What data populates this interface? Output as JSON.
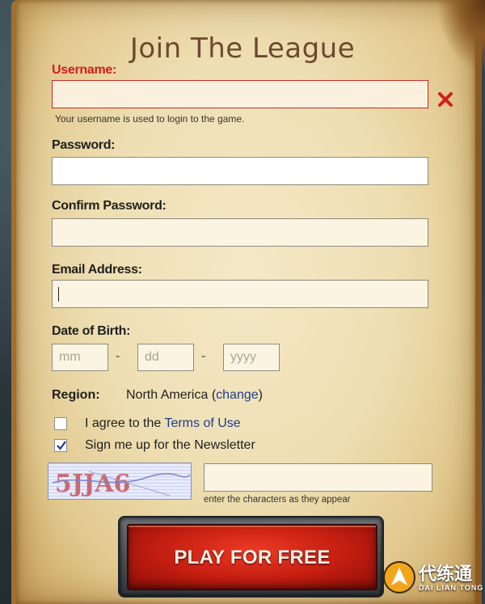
{
  "form": {
    "title": "Join The League",
    "username": {
      "label": "Username:",
      "value": "",
      "hint": "Your username is used to login to the game.",
      "error": true
    },
    "password": {
      "label": "Password:",
      "value": ""
    },
    "confirm_password": {
      "label": "Confirm Password:",
      "value": ""
    },
    "email": {
      "label": "Email Address:",
      "value": ""
    },
    "date_of_birth": {
      "label": "Date of Birth:",
      "month_placeholder": "mm",
      "day_placeholder": "dd",
      "year_placeholder": "yyyy",
      "separator": "-"
    },
    "region": {
      "label": "Region:",
      "value": "North America",
      "open_paren": "(",
      "change_link": "change",
      "close_paren": ")"
    },
    "terms": {
      "checked": false,
      "text": "I agree to the ",
      "link": "Terms of Use"
    },
    "newsletter": {
      "checked": true,
      "text": "Sign me up for the Newsletter"
    },
    "captcha": {
      "image_text": "5JJA6",
      "input_value": "",
      "hint": "enter the characters as they appear"
    },
    "submit_label": "PLAY FOR FREE"
  },
  "watermark": {
    "cn": "代练通",
    "en": "DAI LIAN TONG"
  },
  "colors": {
    "error": "#d21d1d",
    "link": "#1d3d8f",
    "title": "#6b4a2f",
    "button": "#c21d10"
  }
}
